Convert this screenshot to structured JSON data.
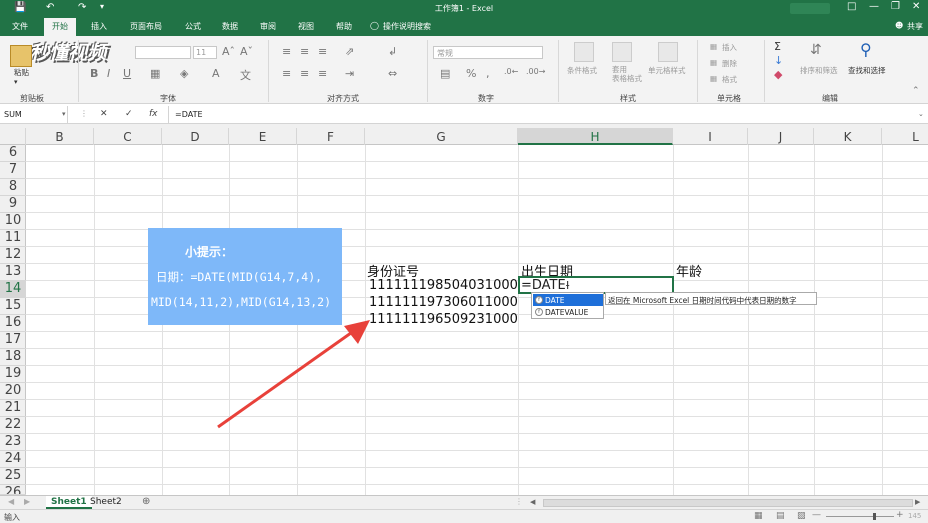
{
  "window": {
    "title": "工作簿1 - Excel",
    "share": "共享"
  },
  "tabs": [
    "文件",
    "开始",
    "插入",
    "页面布局",
    "公式",
    "数据",
    "审阅",
    "视图",
    "帮助"
  ],
  "tell_me": "操作说明搜索",
  "watermark": "秒懂视频",
  "ribbon": {
    "paste": "粘贴",
    "font_size": "11",
    "number_format": "常规",
    "conditional_format": "条件格式",
    "table_format": "套用\n表格格式",
    "cell_style": "单元格样式",
    "insert": "插入",
    "delete": "删除",
    "format": "格式",
    "sort_filter": "排序和筛选",
    "find_select": "查找和选择",
    "groups": [
      "剪贴板",
      "字体",
      "对齐方式",
      "数字",
      "样式",
      "单元格",
      "编辑"
    ]
  },
  "formula_bar": {
    "name_box": "SUM",
    "cancel": "✕",
    "enter": "✓",
    "fx": "fx",
    "content": "=DATE"
  },
  "columns": [
    "B",
    "C",
    "D",
    "E",
    "F",
    "G",
    "H",
    "I",
    "J",
    "K",
    "L"
  ],
  "rows": [
    "6",
    "7",
    "8",
    "9",
    "10",
    "11",
    "12",
    "13",
    "14",
    "15",
    "16",
    "17",
    "18",
    "19",
    "20",
    "21",
    "22",
    "23",
    "24",
    "25",
    "26"
  ],
  "cells": {
    "g13": "身份证号",
    "h13": "出生日期",
    "i13": "年龄",
    "g14": "111111198504031000",
    "g15": "111111197306011000",
    "g16": "111111196509231000",
    "h14": "=DATE"
  },
  "tip": {
    "title": "小提示：",
    "line1": "日期：=DATE(MID(G14,7,4),",
    "line2": "MID(14,11,2),MID(G14,13,2)"
  },
  "autocomplete": {
    "items": [
      "DATE",
      "DATEVALUE"
    ],
    "tooltip": "返回在 Microsoft Excel 日期时间代码中代表日期的数字"
  },
  "sheets": [
    "Sheet1",
    "Sheet2"
  ],
  "status": {
    "mode": "输入",
    "zoom": "145"
  },
  "colors": {
    "excel_green": "#217346",
    "tip_blue": "#7eb8f9",
    "arrow_red": "#e8413a",
    "ac_highlight": "#1e6fd9"
  }
}
